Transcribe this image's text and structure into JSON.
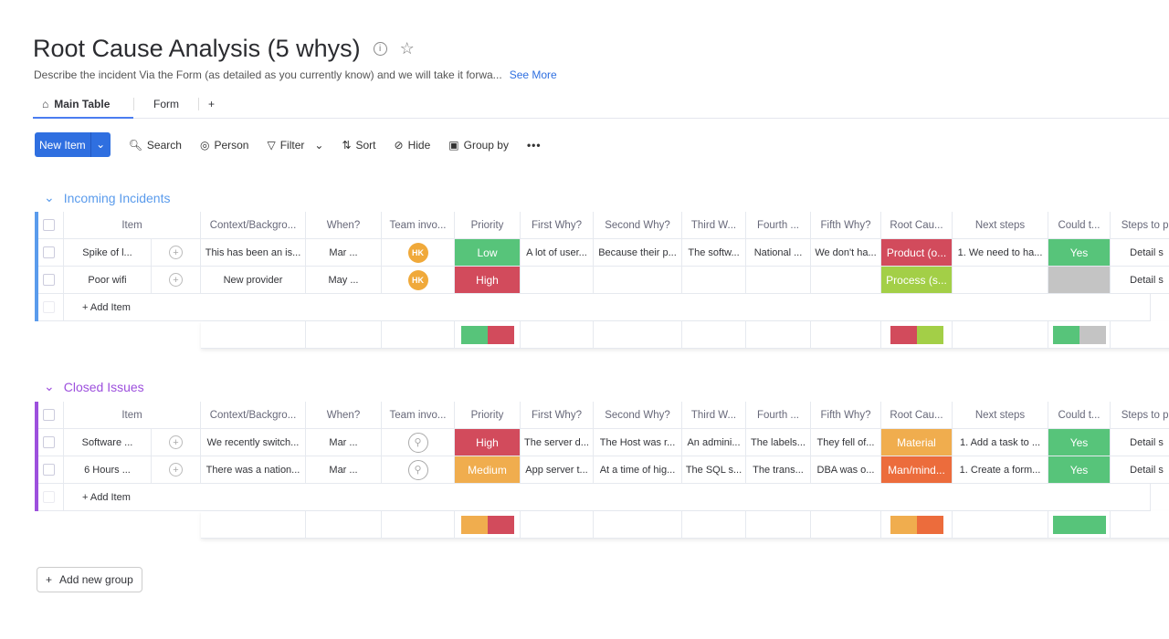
{
  "board": {
    "title": "Root Cause Analysis (5 whys)",
    "description": "Describe the incident Via the Form (as detailed as you currently know) and we will take it forwa...",
    "see_more": "See More"
  },
  "tabs": [
    {
      "label": "Main Table",
      "icon": "home-icon"
    },
    {
      "label": "Form"
    },
    {
      "label": "+"
    }
  ],
  "toolbar": {
    "new_item": "New Item",
    "search": "Search",
    "person": "Person",
    "filter": "Filter",
    "sort": "Sort",
    "hide": "Hide",
    "group_by": "Group by",
    "more": "•••"
  },
  "columns": [
    "Item",
    "Context/Backgro...",
    "When?",
    "Team invo...",
    "Priority",
    "First Why?",
    "Second Why?",
    "Third W...",
    "Fourth ...",
    "Fifth Why?",
    "Root Cau...",
    "Next steps",
    "Could t...",
    "Steps to pr"
  ],
  "colors": {
    "green": "#57c47a",
    "red": "#d24b5c",
    "orange": "#f0ad4e",
    "lime": "#a3cf47",
    "grey": "#c4c4c4",
    "dark_orange": "#ec6c3c"
  },
  "groups": [
    {
      "title": "Incoming Incidents",
      "color": "#5a9bec",
      "add_item": "+ Add Item",
      "rows": [
        {
          "item": "Spike of l...",
          "context": "This has been an is...",
          "when": "Mar ...",
          "team": "HK",
          "priority": {
            "label": "Low",
            "color": "#57c47a"
          },
          "why1": "A lot of user...",
          "why2": "Because their p...",
          "why3": "The softw...",
          "why4": "National ...",
          "why5": "We don't ha...",
          "root": {
            "label": "Product (o...",
            "color": "#d24b5c"
          },
          "next": "1. We need to ha...",
          "could": {
            "label": "Yes",
            "color": "#57c47a"
          },
          "steps": "Detail s"
        },
        {
          "item": "Poor wifi",
          "context": "New provider",
          "when": "May ...",
          "team": "HK",
          "priority": {
            "label": "High",
            "color": "#d24b5c"
          },
          "why1": "",
          "why2": "",
          "why3": "",
          "why4": "",
          "why5": "",
          "root": {
            "label": "Process (s...",
            "color": "#a3cf47"
          },
          "next": "",
          "could": {
            "label": "",
            "color": "#c4c4c4"
          },
          "steps": "Detail s"
        }
      ],
      "summary": {
        "priority": [
          "#57c47a",
          "#d24b5c"
        ],
        "root": [
          "#d24b5c",
          "#a3cf47"
        ],
        "could": [
          "#57c47a",
          "#c4c4c4"
        ]
      }
    },
    {
      "title": "Closed Issues",
      "color": "#9d50dd",
      "add_item": "+ Add Item",
      "rows": [
        {
          "item": "Software ...",
          "context": "We recently switch...",
          "when": "Mar ...",
          "team": "",
          "priority": {
            "label": "High",
            "color": "#d24b5c"
          },
          "why1": "The server d...",
          "why2": "The Host was r...",
          "why3": "An admini...",
          "why4": "The labels...",
          "why5": "They fell of...",
          "root": {
            "label": "Material",
            "color": "#f0ad4e"
          },
          "next": "1. Add a task to ...",
          "could": {
            "label": "Yes",
            "color": "#57c47a"
          },
          "steps": "Detail s"
        },
        {
          "item": "6 Hours ...",
          "context": "There was a nation...",
          "when": "Mar ...",
          "team": "",
          "priority": {
            "label": "Medium",
            "color": "#f0ad4e"
          },
          "why1": "App server t...",
          "why2": "At a time of hig...",
          "why3": "The SQL s...",
          "why4": "The trans...",
          "why5": "DBA was o...",
          "root": {
            "label": "Man/mind...",
            "color": "#ec6c3c"
          },
          "next": "1. Create a form...",
          "could": {
            "label": "Yes",
            "color": "#57c47a"
          },
          "steps": "Detail s"
        }
      ],
      "summary": {
        "priority": [
          "#f0ad4e",
          "#d24b5c"
        ],
        "root": [
          "#f0ad4e",
          "#ec6c3c"
        ],
        "could": [
          "#57c47a"
        ]
      }
    }
  ],
  "add_new_group": "Add new group"
}
